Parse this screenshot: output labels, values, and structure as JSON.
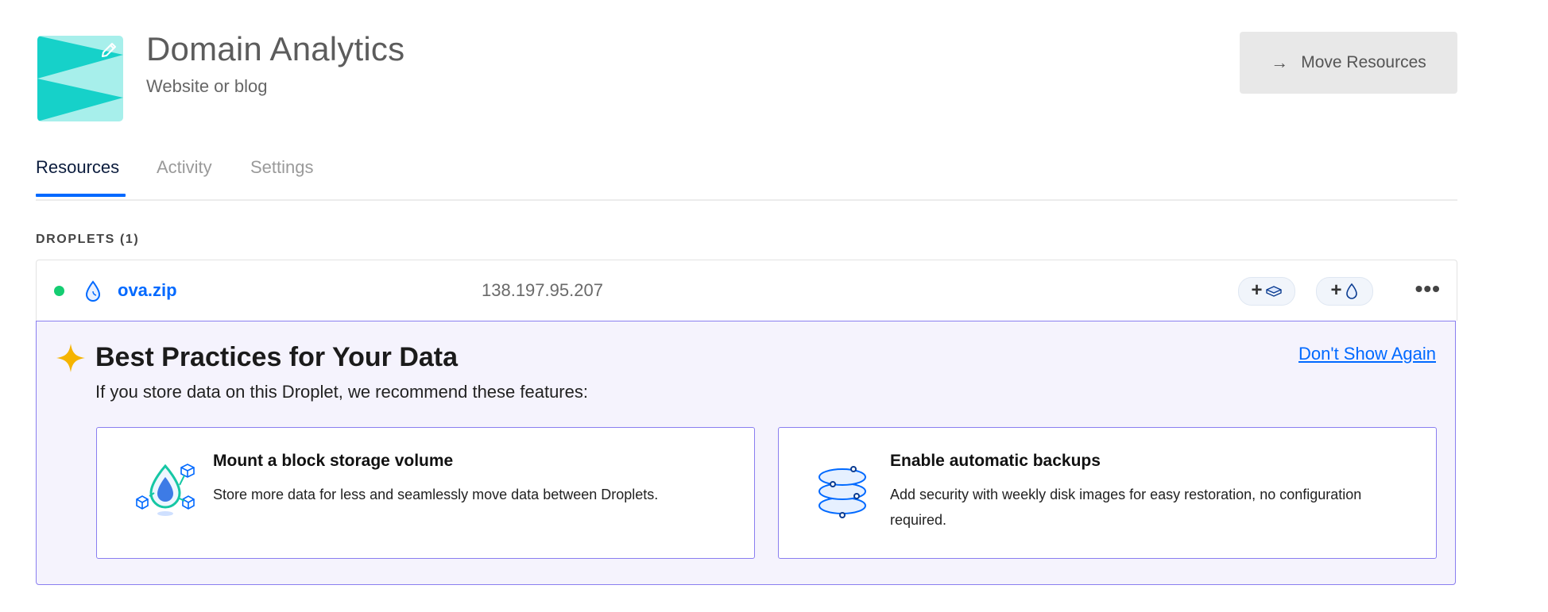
{
  "project": {
    "title": "Domain Analytics",
    "subtitle": "Website or blog",
    "icon": "project-pennant-icon",
    "edit_icon": "pencil-icon"
  },
  "header_actions": {
    "move_label": "Move Resources",
    "move_icon": "arrow-right-icon"
  },
  "tabs": [
    {
      "label": "Resources",
      "active": true
    },
    {
      "label": "Activity",
      "active": false
    },
    {
      "label": "Settings",
      "active": false
    }
  ],
  "section": {
    "label": "DROPLETS (1)"
  },
  "droplet": {
    "status": "active",
    "status_color": "#15cd72",
    "icon": "droplet-icon",
    "name": "ova.zip",
    "ip": "138.197.95.207",
    "actions": [
      {
        "name": "add-volume-button",
        "icon": "volume-icon"
      },
      {
        "name": "add-floating-ip-button",
        "icon": "droplet-icon"
      }
    ],
    "more_label": "•••"
  },
  "best_practices": {
    "icon": "sparkle-icon",
    "title": "Best Practices for Your Data",
    "description": "If you store data on this Droplet, we recommend these features:",
    "dismiss_label": "Don't Show Again",
    "cards": [
      {
        "icon": "block-storage-icon",
        "title": "Mount a block storage volume",
        "description": "Store more data for less and seamlessly move data between Droplets."
      },
      {
        "icon": "backups-icon",
        "title": "Enable automatic backups",
        "description": "Add security with weekly disk images for easy restoration, no configuration required."
      }
    ]
  },
  "colors": {
    "accent": "#0069ff",
    "panel_border": "#8a7ef0",
    "panel_bg": "#f5f3fd",
    "sparkle": "#f5b400",
    "project_teal": "#16d1c9"
  }
}
